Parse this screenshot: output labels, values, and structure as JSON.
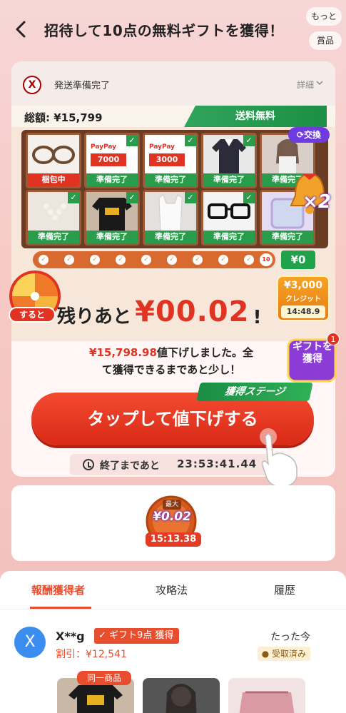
{
  "header": {
    "title": "招待して10点の無料ギフトを獲得！",
    "more_label": "もっと",
    "prize_label": "賞品"
  },
  "shipping": {
    "logo_text": "X",
    "status": "発送準備完了",
    "detail_label": "詳細"
  },
  "gift_panel": {
    "total_label": "総額: ¥15,799",
    "free_shipping_label": "送料無料",
    "swap_label": "交換",
    "multiplier_label": "×2",
    "items": [
      {
        "status": "梱包中",
        "checked": false,
        "image": "glasses"
      },
      {
        "status": "準備完了",
        "checked": true,
        "image": "paypay-7000",
        "amount": "7000"
      },
      {
        "status": "準備完了",
        "checked": true,
        "image": "paypay-3000",
        "amount": "3000"
      },
      {
        "status": "準備完了",
        "checked": true,
        "image": "blouse"
      },
      {
        "status": "準備完了",
        "checked": true,
        "image": "model"
      },
      {
        "status": "準備完了",
        "checked": true,
        "image": "necklace"
      },
      {
        "status": "準備完了",
        "checked": true,
        "image": "tshirt"
      },
      {
        "status": "準備完了",
        "checked": true,
        "image": "tank-top"
      },
      {
        "status": "準備完了",
        "checked": true,
        "image": "glasses-2"
      },
      {
        "status": "準備完了",
        "checked": true,
        "image": "mirror"
      }
    ],
    "paypay_label": "PayPay",
    "progress_end_label": "10",
    "progress_badge": "¥0"
  },
  "credit": {
    "amount": "¥3,000",
    "label": "クレジット",
    "timer": "14:48.9"
  },
  "wheel_label": "すると",
  "remaining": {
    "prefix": "残りあと",
    "amount": "¥00.02",
    "suffix": "!"
  },
  "reduced": {
    "amount": "¥15,798.98",
    "line1_rest": "値下げしました。全",
    "line2": "て獲得できるまであと少し！"
  },
  "gift_side": {
    "label": "ギフトを獲得",
    "badge": "1"
  },
  "stage_label": "獲得ステージ",
  "tap_button_label": "タップして値下げする",
  "countdown": {
    "label": "終了まであと",
    "timer": "23:53:41.44"
  },
  "max_reward": {
    "label": "最大",
    "amount": "¥0.02",
    "timer": "15:13.38"
  },
  "tabs": [
    {
      "label": "報酬獲得者",
      "active": true
    },
    {
      "label": "攻略法",
      "active": false
    },
    {
      "label": "履歴",
      "active": false
    }
  ],
  "winner": {
    "avatar_letter": "X",
    "name": "X**g",
    "badge": "ギフト9点 獲得",
    "discount": "割引：¥12,541",
    "time": "たった今",
    "received": "受取済み",
    "same_product_label": "同一商品"
  },
  "colors": {
    "accent_red": "#e03322",
    "ready_green": "#2a9d4d",
    "tab_active": "#e84d2e"
  }
}
